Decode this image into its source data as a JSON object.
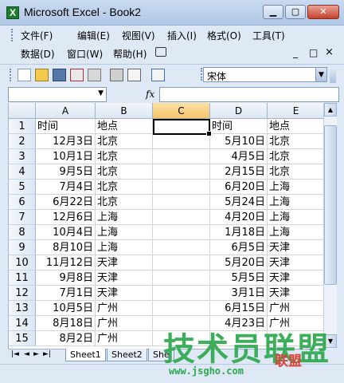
{
  "window": {
    "title": "Microsoft Excel - Book2",
    "minimize": "▁",
    "restore": "▢",
    "close": "✕"
  },
  "menubar": {
    "row1": [
      "文件(F)",
      "编辑(E)",
      "视图(V)",
      "插入(I)",
      "格式(O)",
      "工具(T)"
    ],
    "row2": [
      "数据(D)",
      "窗口(W)",
      "帮助(H)"
    ],
    "doc_controls": [
      "_",
      "□",
      "×"
    ]
  },
  "toolbar": {
    "font_name": "宋体"
  },
  "formula_bar": {
    "name_box": "",
    "fx": "fx",
    "content": ""
  },
  "grid": {
    "columns": [
      "A",
      "B",
      "C",
      "D",
      "E"
    ],
    "selected_column": "C",
    "active_cell": "C1",
    "rows": [
      {
        "n": "1",
        "A": "时间",
        "B": "地点",
        "C": "",
        "D": "时间",
        "E": "地点"
      },
      {
        "n": "2",
        "A": "12月3日",
        "B": "北京",
        "C": "",
        "D": "5月10日",
        "E": "北京"
      },
      {
        "n": "3",
        "A": "10月1日",
        "B": "北京",
        "C": "",
        "D": "4月5日",
        "E": "北京"
      },
      {
        "n": "4",
        "A": "9月5日",
        "B": "北京",
        "C": "",
        "D": "2月15日",
        "E": "北京"
      },
      {
        "n": "5",
        "A": "7月4日",
        "B": "北京",
        "C": "",
        "D": "6月20日",
        "E": "上海"
      },
      {
        "n": "6",
        "A": "6月22日",
        "B": "北京",
        "C": "",
        "D": "5月24日",
        "E": "上海"
      },
      {
        "n": "7",
        "A": "12月6日",
        "B": "上海",
        "C": "",
        "D": "4月20日",
        "E": "上海"
      },
      {
        "n": "8",
        "A": "10月4日",
        "B": "上海",
        "C": "",
        "D": "1月18日",
        "E": "上海"
      },
      {
        "n": "9",
        "A": "8月10日",
        "B": "上海",
        "C": "",
        "D": "6月5日",
        "E": "天津"
      },
      {
        "n": "10",
        "A": "11月12日",
        "B": "天津",
        "C": "",
        "D": "5月20日",
        "E": "天津"
      },
      {
        "n": "11",
        "A": "9月8日",
        "B": "天津",
        "C": "",
        "D": "5月5日",
        "E": "天津"
      },
      {
        "n": "12",
        "A": "7月1日",
        "B": "天津",
        "C": "",
        "D": "3月1日",
        "E": "天津"
      },
      {
        "n": "13",
        "A": "10月5日",
        "B": "广州",
        "C": "",
        "D": "6月15日",
        "E": "广州"
      },
      {
        "n": "14",
        "A": "8月18日",
        "B": "广州",
        "C": "",
        "D": "4月23日",
        "E": "广州"
      },
      {
        "n": "15",
        "A": "8月2日",
        "B": "广州",
        "C": "",
        "D": "",
        "E": ""
      }
    ]
  },
  "sheets": {
    "tabs": [
      "Sheet1",
      "Sheet2",
      "She"
    ],
    "active": "Sheet1"
  },
  "watermark": {
    "cn": "技术员联盟",
    "url": "www.jsgho.com",
    "brand": "联盟"
  },
  "colors": {
    "selected_header": "#f7c46b",
    "watermark_green": "#2ea84f",
    "excel_green": "#1d7a2f"
  }
}
